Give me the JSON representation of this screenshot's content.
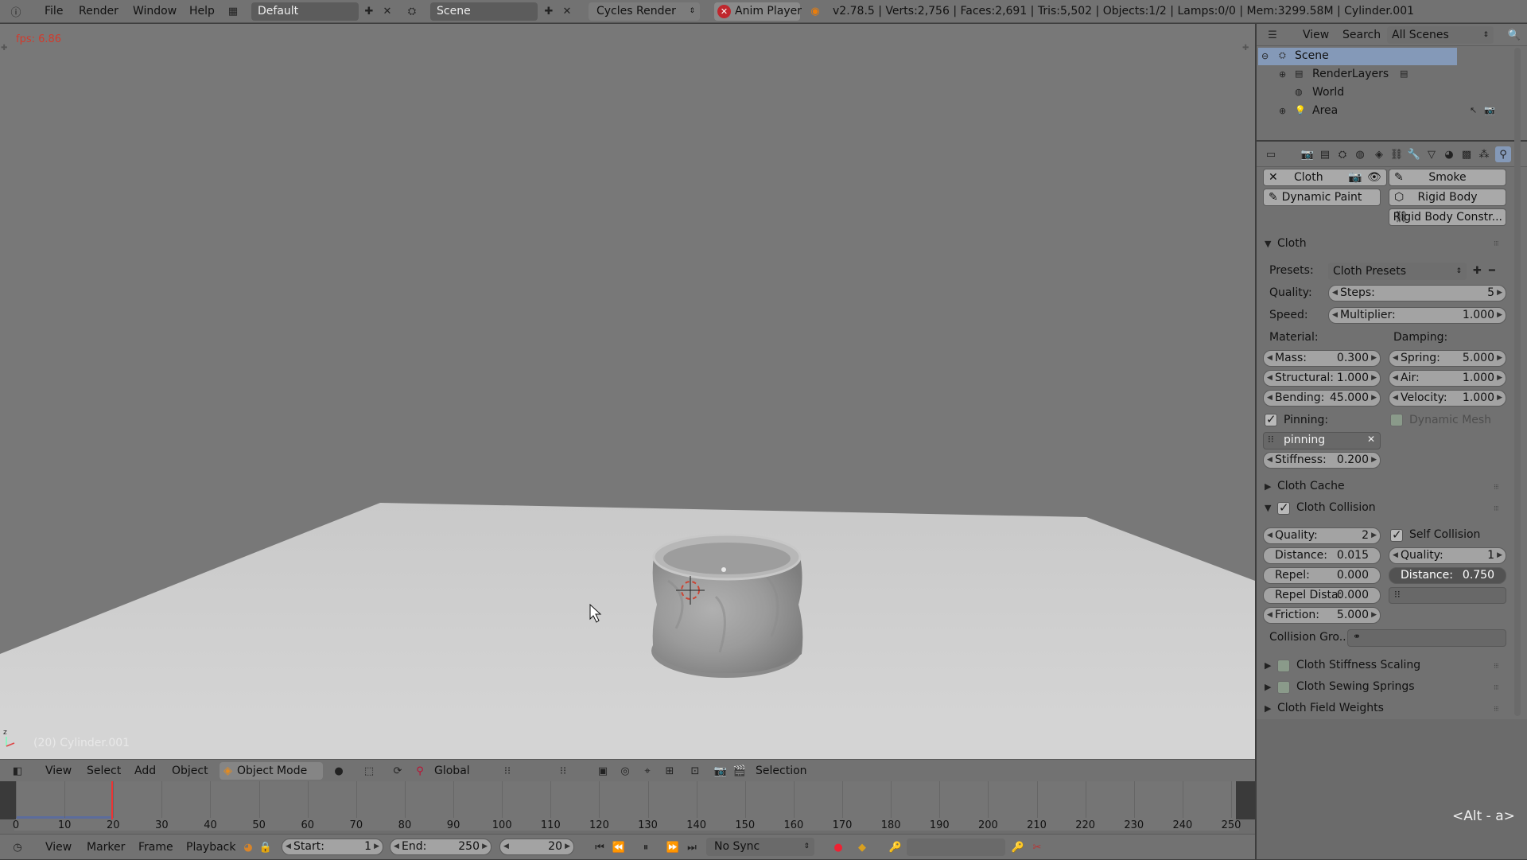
{
  "topbar": {
    "menu": [
      "File",
      "Render",
      "Window",
      "Help"
    ],
    "screen_layout": "Default",
    "scene": "Scene",
    "engine": "Cycles Render",
    "anim_player": "Anim Player",
    "stats": "v2.78.5 | Verts:2,756 | Faces:2,691 | Tris:5,502 | Objects:1/2 | Lamps:0/0 | Mem:3299.58M | Cylinder.001"
  },
  "viewport": {
    "fps": "fps: 6.86",
    "object_label": "(20) Cylinder.001",
    "shortcut_hint": "<Alt - a>"
  },
  "view3d_header": {
    "menus": [
      "View",
      "Select",
      "Add",
      "Object"
    ],
    "mode": "Object Mode",
    "orientation": "Global",
    "selection": "Selection"
  },
  "timeline": {
    "ticks": [
      "0",
      "10",
      "20",
      "30",
      "40",
      "50",
      "60",
      "70",
      "80",
      "90",
      "100",
      "110",
      "120",
      "130",
      "140",
      "150",
      "160",
      "170",
      "180",
      "190",
      "200",
      "210",
      "220",
      "230",
      "240",
      "250"
    ],
    "current_frame_marker": 20,
    "menus": [
      "View",
      "Marker",
      "Frame",
      "Playback"
    ],
    "start_label": "Start:",
    "start_value": "1",
    "end_label": "End:",
    "end_value": "250",
    "current_frame": "20",
    "sync": "No Sync"
  },
  "outliner": {
    "menus": [
      "View",
      "Search"
    ],
    "display": "All Scenes",
    "items": [
      "Scene",
      "RenderLayers",
      "World",
      "Area"
    ]
  },
  "physics": {
    "buttons": {
      "cloth": "Cloth",
      "smoke": "Smoke",
      "dynamic_paint": "Dynamic Paint",
      "rigid_body": "Rigid Body",
      "rigid_body_constr": "Rigid Body Constr..."
    },
    "cloth_panel": {
      "title": "Cloth",
      "presets_label": "Presets:",
      "presets_value": "Cloth Presets",
      "quality_label": "Quality:",
      "steps_label": "Steps:",
      "steps_value": "5",
      "speed_label": "Speed:",
      "multiplier_label": "Multiplier:",
      "multiplier_value": "1.000",
      "material_label": "Material:",
      "damping_label": "Damping:",
      "mass_label": "Mass:",
      "mass_value": "0.300",
      "structural_label": "Structural:",
      "structural_value": "1.000",
      "bending_label": "Bending:",
      "bending_value": "45.000",
      "spring_label": "Spring:",
      "spring_value": "5.000",
      "air_label": "Air:",
      "air_value": "1.000",
      "velocity_label": "Velocity:",
      "velocity_value": "1.000",
      "pinning_label": "Pinning:",
      "dynamic_mesh_label": "Dynamic Mesh",
      "pin_group": "pinning",
      "stiffness_label": "Stiffness:",
      "stiffness_value": "0.200"
    },
    "cloth_cache": "Cloth Cache",
    "collision_panel": {
      "title": "Cloth Collision",
      "quality_label": "Quality:",
      "quality_value": "2",
      "distance_label": "Distance:",
      "distance_value": "0.015",
      "repel_label": "Repel:",
      "repel_value": "0.000",
      "repel_dist_label": "Repel Dista:",
      "repel_dist_value": "0.000",
      "friction_label": "Friction:",
      "friction_value": "5.000",
      "self_collision": "Self Collision",
      "self_quality_label": "Quality:",
      "self_quality_value": "1",
      "self_distance_label": "Distance:",
      "self_distance_value": "0.750",
      "collision_group_label": "Collision Gro..."
    },
    "stiffness_scaling": "Cloth Stiffness Scaling",
    "sewing_springs": "Cloth Sewing Springs",
    "field_weights": "Cloth Field Weights"
  }
}
